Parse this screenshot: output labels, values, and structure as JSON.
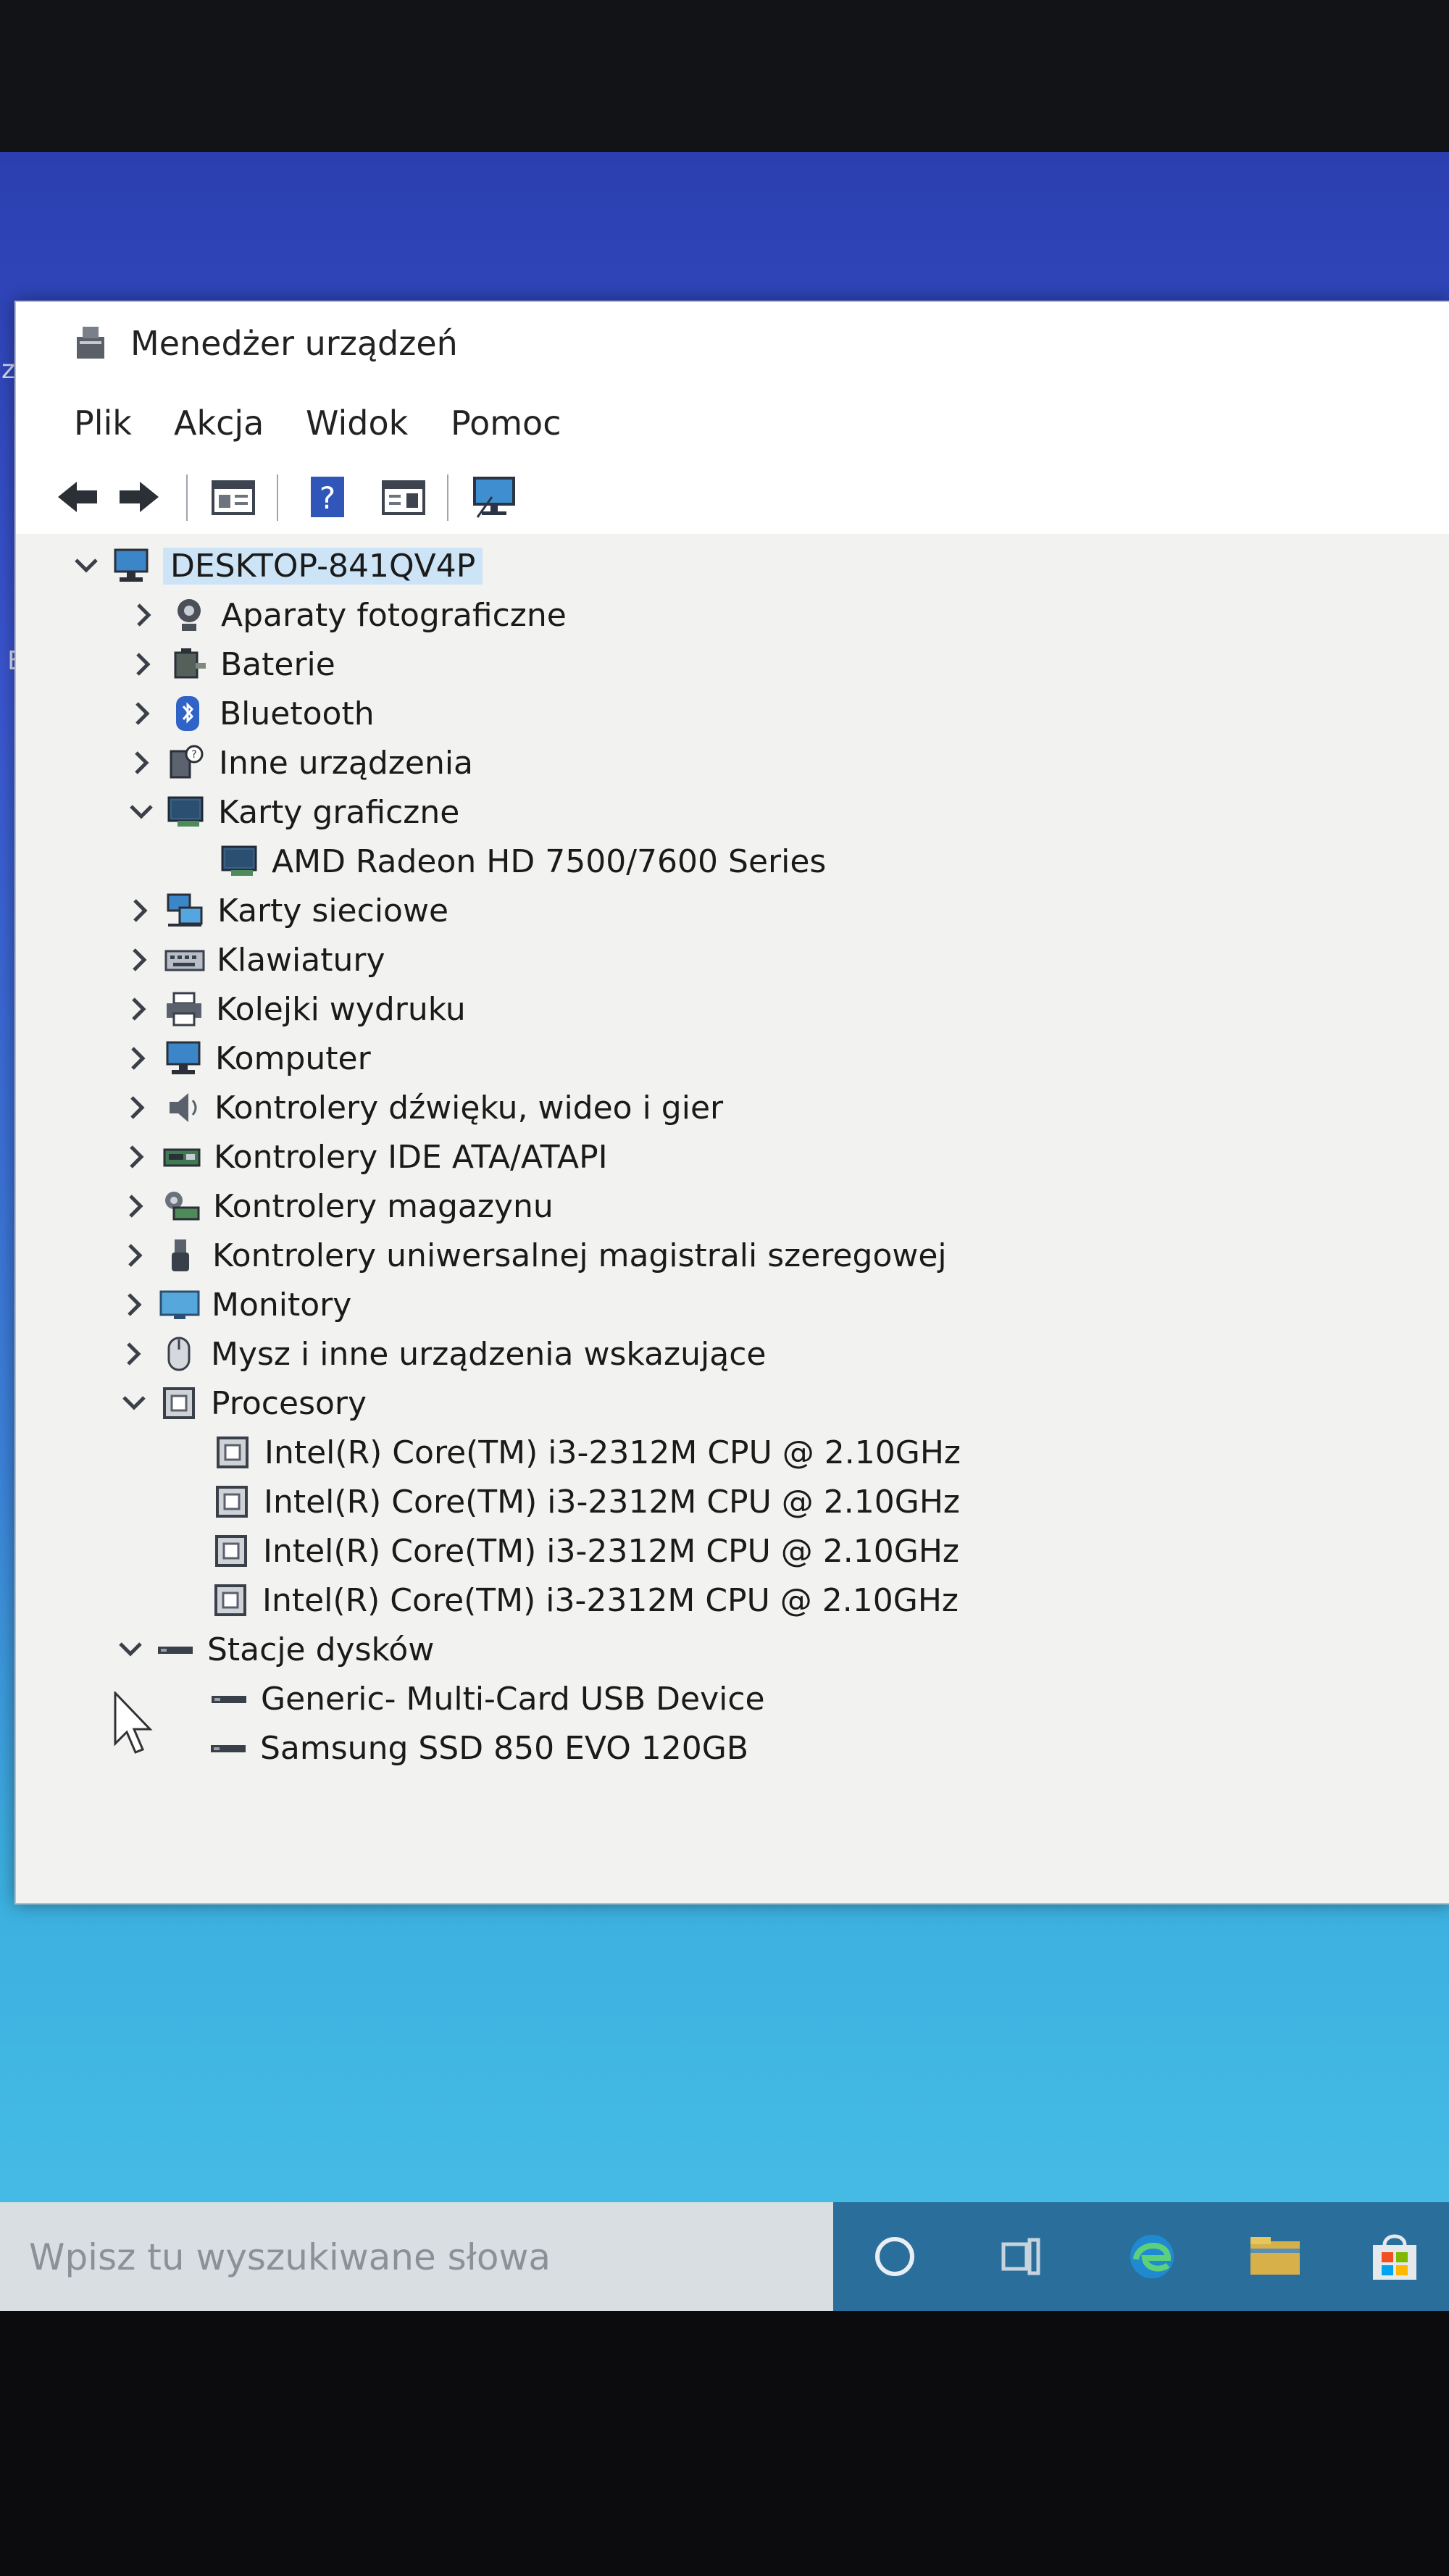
{
  "window": {
    "title": "Menedżer urządzeń"
  },
  "menu": {
    "items": [
      "Plik",
      "Akcja",
      "Widok",
      "Pomoc"
    ]
  },
  "tree": {
    "root": "DESKTOP-841QV4P",
    "categories": [
      {
        "label": "Aparaty fotograficzne",
        "icon": "camera-icon"
      },
      {
        "label": "Baterie",
        "icon": "battery-icon"
      },
      {
        "label": "Bluetooth",
        "icon": "bluetooth-icon"
      },
      {
        "label": "Inne urządzenia",
        "icon": "other-devices-icon"
      },
      {
        "label": "Karty graficzne",
        "icon": "display-adapter-icon",
        "expanded": true
      },
      {
        "label": "AMD Radeon HD 7500/7600 Series",
        "icon": "display-adapter-icon"
      },
      {
        "label": "Karty sieciowe",
        "icon": "network-adapter-icon"
      },
      {
        "label": "Klawiatury",
        "icon": "keyboard-icon"
      },
      {
        "label": "Kolejki wydruku",
        "icon": "printer-icon"
      },
      {
        "label": "Komputer",
        "icon": "computer-icon"
      },
      {
        "label": "Kontrolery dźwięku, wideo i gier",
        "icon": "speaker-icon"
      },
      {
        "label": "Kontrolery IDE ATA/ATAPI",
        "icon": "ide-controller-icon"
      },
      {
        "label": "Kontrolery magazynu",
        "icon": "storage-controller-icon"
      },
      {
        "label": "Kontrolery uniwersalnej magistrali szeregowej",
        "icon": "usb-icon"
      },
      {
        "label": "Monitory",
        "icon": "monitor-icon"
      },
      {
        "label": "Mysz i inne urządzenia wskazujące",
        "icon": "mouse-icon"
      },
      {
        "label": "Procesory",
        "icon": "processor-icon",
        "expanded": true
      },
      {
        "label": "Intel(R) Core(TM) i3-2312M CPU @ 2.10GHz",
        "icon": "processor-icon"
      },
      {
        "label": "Intel(R) Core(TM) i3-2312M CPU @ 2.10GHz",
        "icon": "processor-icon"
      },
      {
        "label": "Intel(R) Core(TM) i3-2312M CPU @ 2.10GHz",
        "icon": "processor-icon"
      },
      {
        "label": "Intel(R) Core(TM) i3-2312M CPU @ 2.10GHz",
        "icon": "processor-icon"
      },
      {
        "label": "Stacje dysków",
        "icon": "disk-drive-icon",
        "expanded": true
      },
      {
        "label": "Generic- Multi-Card USB Device",
        "icon": "disk-drive-icon"
      },
      {
        "label": "Samsung SSD 850 EVO 120GB",
        "icon": "disk-drive-icon"
      }
    ]
  },
  "desktop": {
    "side_letters": [
      "z",
      "E"
    ]
  },
  "taskbar": {
    "search_placeholder": "Wpisz tu wyszukiwane słowa"
  },
  "colors": {
    "selection": "#cde4f7",
    "desktop_blue": "#3a55cf",
    "taskbar": "#2a6f9c"
  }
}
